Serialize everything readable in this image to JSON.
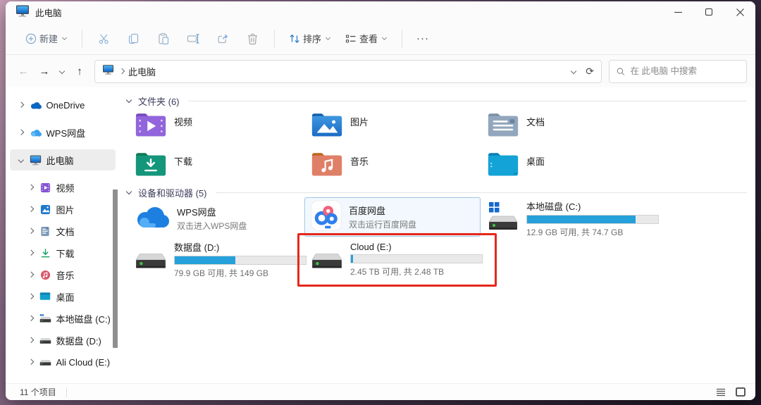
{
  "colors": {
    "progress_blue": "#26a0da",
    "annotation_red": "#e5281b",
    "selection_border": "#9cc7e8"
  },
  "titlebar": {
    "title": "此电脑"
  },
  "toolbar": {
    "new_label": "新建",
    "sort_label": "排序",
    "view_label": "查看",
    "more_label": "···"
  },
  "addressbar": {
    "breadcrumb_root": "此电脑",
    "search_placeholder": "在 此电脑 中搜索"
  },
  "sidebar": {
    "items": [
      {
        "label": "OneDrive",
        "icon": "onedrive-cloud-icon"
      },
      {
        "label": "WPS网盘",
        "icon": "wps-cloud-icon"
      },
      {
        "label": "此电脑",
        "icon": "computer-icon",
        "selected": true,
        "expanded": true
      },
      {
        "label": "视频",
        "icon": "videos-icon"
      },
      {
        "label": "图片",
        "icon": "pictures-icon"
      },
      {
        "label": "文档",
        "icon": "documents-icon"
      },
      {
        "label": "下载",
        "icon": "downloads-icon"
      },
      {
        "label": "音乐",
        "icon": "music-icon"
      },
      {
        "label": "桌面",
        "icon": "desktop-icon"
      },
      {
        "label": "本地磁盘 (C:)",
        "icon": "system-drive-icon"
      },
      {
        "label": "数据盘 (D:)",
        "icon": "drive-icon"
      },
      {
        "label": "Ali Cloud (E:)",
        "icon": "drive-icon"
      }
    ]
  },
  "content": {
    "folders_section": {
      "title": "文件夹 (6)"
    },
    "folders": [
      {
        "label": "视频"
      },
      {
        "label": "图片"
      },
      {
        "label": "文档"
      },
      {
        "label": "下载"
      },
      {
        "label": "音乐"
      },
      {
        "label": "桌面"
      }
    ],
    "drives_section": {
      "title": "设备和驱动器 (5)"
    },
    "drives": [
      {
        "name": "WPS网盘",
        "subtitle": "双击进入WPS网盘"
      },
      {
        "name": "百度网盘",
        "subtitle": "双击运行百度网盘",
        "selected": true
      },
      {
        "name": "本地磁盘 (C:)",
        "capacity": "12.9 GB 可用, 共 74.7 GB",
        "used_percent": 83
      },
      {
        "name": "数据盘 (D:)",
        "capacity": "79.9 GB 可用, 共 149 GB",
        "used_percent": 46
      },
      {
        "name": "Cloud (E:)",
        "capacity": "2.45 TB 可用, 共 2.48 TB",
        "used_percent": 1.5,
        "annotated": true
      }
    ]
  },
  "statusbar": {
    "items_count": "11 个项目"
  }
}
